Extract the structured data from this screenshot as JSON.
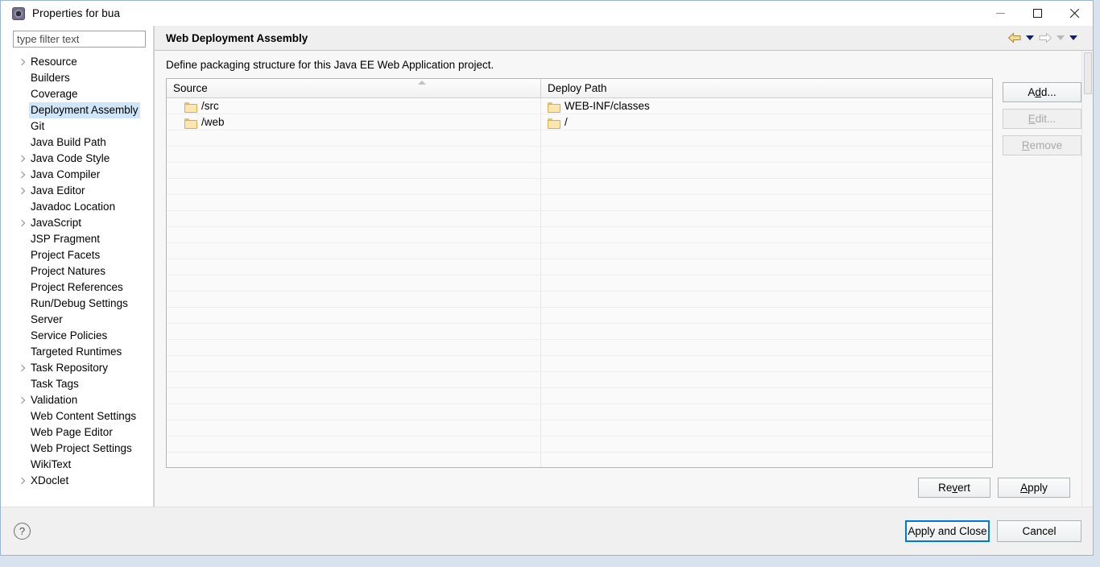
{
  "window": {
    "title": "Properties for bua",
    "icon": "properties-gear-icon",
    "minimize_label": "Minimize",
    "maximize_label": "Maximize",
    "close_label": "Close"
  },
  "sidebar": {
    "filter": {
      "placeholder": "type filter text",
      "value": ""
    },
    "items": [
      {
        "label": "Resource",
        "expandable": true,
        "selected": false
      },
      {
        "label": "Builders",
        "expandable": false,
        "selected": false
      },
      {
        "label": "Coverage",
        "expandable": false,
        "selected": false
      },
      {
        "label": "Deployment Assembly",
        "expandable": false,
        "selected": true
      },
      {
        "label": "Git",
        "expandable": false,
        "selected": false
      },
      {
        "label": "Java Build Path",
        "expandable": false,
        "selected": false
      },
      {
        "label": "Java Code Style",
        "expandable": true,
        "selected": false
      },
      {
        "label": "Java Compiler",
        "expandable": true,
        "selected": false
      },
      {
        "label": "Java Editor",
        "expandable": true,
        "selected": false
      },
      {
        "label": "Javadoc Location",
        "expandable": false,
        "selected": false
      },
      {
        "label": "JavaScript",
        "expandable": true,
        "selected": false
      },
      {
        "label": "JSP Fragment",
        "expandable": false,
        "selected": false
      },
      {
        "label": "Project Facets",
        "expandable": false,
        "selected": false
      },
      {
        "label": "Project Natures",
        "expandable": false,
        "selected": false
      },
      {
        "label": "Project References",
        "expandable": false,
        "selected": false
      },
      {
        "label": "Run/Debug Settings",
        "expandable": false,
        "selected": false
      },
      {
        "label": "Server",
        "expandable": false,
        "selected": false
      },
      {
        "label": "Service Policies",
        "expandable": false,
        "selected": false
      },
      {
        "label": "Targeted Runtimes",
        "expandable": false,
        "selected": false
      },
      {
        "label": "Task Repository",
        "expandable": true,
        "selected": false
      },
      {
        "label": "Task Tags",
        "expandable": false,
        "selected": false
      },
      {
        "label": "Validation",
        "expandable": true,
        "selected": false
      },
      {
        "label": "Web Content Settings",
        "expandable": false,
        "selected": false
      },
      {
        "label": "Web Page Editor",
        "expandable": false,
        "selected": false
      },
      {
        "label": "Web Project Settings",
        "expandable": false,
        "selected": false
      },
      {
        "label": "WikiText",
        "expandable": false,
        "selected": false
      },
      {
        "label": "XDoclet",
        "expandable": true,
        "selected": false
      }
    ]
  },
  "page": {
    "title": "Web Deployment Assembly",
    "description": "Define packaging structure for this Java EE Web Application project.",
    "nav": {
      "back_icon": "back-arrow-icon",
      "back_menu_icon": "chevron-down-icon",
      "forward_icon": "forward-arrow-icon",
      "forward_menu_icon": "chevron-down-icon",
      "more_menu_icon": "chevron-down-icon"
    }
  },
  "table": {
    "columns": [
      "Source",
      "Deploy Path"
    ],
    "sort_indicator": "ascending-caret-icon",
    "rows": [
      {
        "source": "/src",
        "deploy_path": "WEB-INF/classes",
        "icon": "folder-icon"
      },
      {
        "source": "/web",
        "deploy_path": "/",
        "icon": "folder-icon"
      }
    ],
    "empty_rows": 22
  },
  "side_buttons": [
    {
      "label": "Add...",
      "mnemonic": "d",
      "enabled": true
    },
    {
      "label": "Edit...",
      "mnemonic": "E",
      "enabled": false
    },
    {
      "label": "Remove",
      "mnemonic": "R",
      "enabled": false
    }
  ],
  "apply_row": [
    {
      "label": "Revert",
      "mnemonic": "v",
      "enabled": true
    },
    {
      "label": "Apply",
      "mnemonic": "A",
      "enabled": true
    }
  ],
  "footer": {
    "help_icon": "help-question-icon",
    "buttons": [
      {
        "label": "Apply and Close",
        "primary": true
      },
      {
        "label": "Cancel",
        "primary": false
      }
    ]
  },
  "colors": {
    "selection": "#cfe6f9",
    "focus_border": "#0078d7",
    "folder": "#fbe6b0",
    "back_arrow": "#f2d98a"
  }
}
